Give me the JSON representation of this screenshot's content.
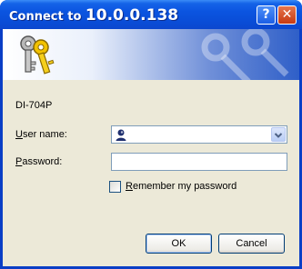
{
  "window": {
    "title_prefix": "Connect to ",
    "title_host": "10.0.0.138",
    "help_glyph": "?",
    "close_glyph": "✕"
  },
  "banner": {
    "icon": "keys-icon"
  },
  "form": {
    "site_name": "DI-704P",
    "user_label_hotkey": "U",
    "user_label_rest": "ser name:",
    "user_value": "",
    "password_label_hotkey": "P",
    "password_label_rest": "assword:",
    "password_value": "",
    "remember_hotkey": "R",
    "remember_rest": "emember my password",
    "remember_checked": false
  },
  "buttons": {
    "ok": "OK",
    "cancel": "Cancel"
  },
  "colors": {
    "titlebar": "#0a4ed8",
    "client": "#ece9d8",
    "button_border": "#003c74"
  }
}
